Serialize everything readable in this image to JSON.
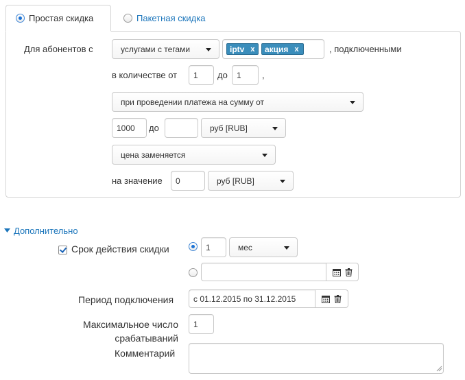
{
  "tabs": [
    {
      "label": "Простая скидка",
      "active": true
    },
    {
      "label": "Пакетная скидка",
      "active": false
    }
  ],
  "rule": {
    "for_subscribers_label": "Для абонентов с",
    "services_select": "услугами с тегами",
    "tags": [
      {
        "label": "iptv",
        "remove": "x"
      },
      {
        "label": "акция",
        "remove": "x"
      }
    ],
    "connected_suffix": ", подключенными",
    "quantity_from_label": "в количестве от",
    "quantity_from": "1",
    "quantity_to_label": "до",
    "quantity_to": "1",
    "quantity_comma": ",",
    "payment_select": "при проведении платежа на сумму от",
    "amount_from": "1000",
    "amount_to_label": "до",
    "amount_to": "",
    "amount_currency": "руб [RUB]",
    "price_select": "цена заменяется",
    "value_label": "на значение",
    "value": "0",
    "value_currency": "руб [RUB]"
  },
  "additional": {
    "toggle_label": "Дополнительно",
    "validity_label": "Срок действия скидки",
    "validity_checked": true,
    "validity_amount": "1",
    "validity_unit": "мес",
    "validity_date_range": "",
    "period_label": "Период подключения",
    "period_value": "с 01.12.2015 по 31.12.2015",
    "max_uses_label_line1": "Максимальное число",
    "max_uses_label_line2": "срабатываний",
    "max_uses_value": "1",
    "comment_label": "Комментарий",
    "comment_value": ""
  },
  "colors": {
    "accent": "#1b75bb",
    "tag_bg": "#3a8dbb",
    "border": "#d4d4d4"
  },
  "icons": [
    "calendar-icon",
    "trash-icon",
    "caret-down-icon",
    "resize-grip-icon"
  ]
}
